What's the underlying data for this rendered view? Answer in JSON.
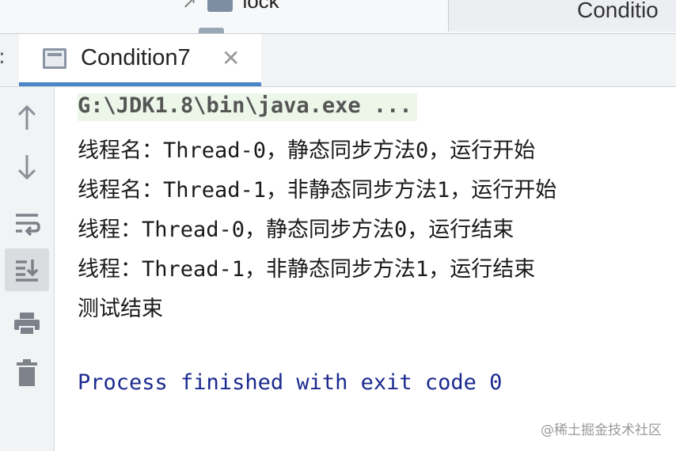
{
  "project_tree": {
    "row1": "lock",
    "row2": ""
  },
  "editor_tab": {
    "label": "Conditio"
  },
  "run_tab": {
    "label": "Condition7",
    "close": "✕"
  },
  "toolbar": {
    "up": "up-arrow",
    "down": "down-arrow",
    "wrap": "soft-wrap",
    "scroll": "scroll-to-end",
    "print": "print",
    "clear": "trash"
  },
  "console": {
    "command": "G:\\JDK1.8\\bin\\java.exe ...",
    "lines": [
      "线程名：Thread-0，静态同步方法0，运行开始",
      "线程名：Thread-1，非静态同步方法1，运行开始",
      "线程：Thread-0，静态同步方法0，运行结束",
      "线程：Thread-1，非静态同步方法1，运行结束",
      "测试结束"
    ],
    "exit": "Process finished with exit code 0"
  },
  "watermark": "@稀土掘金技术社区"
}
